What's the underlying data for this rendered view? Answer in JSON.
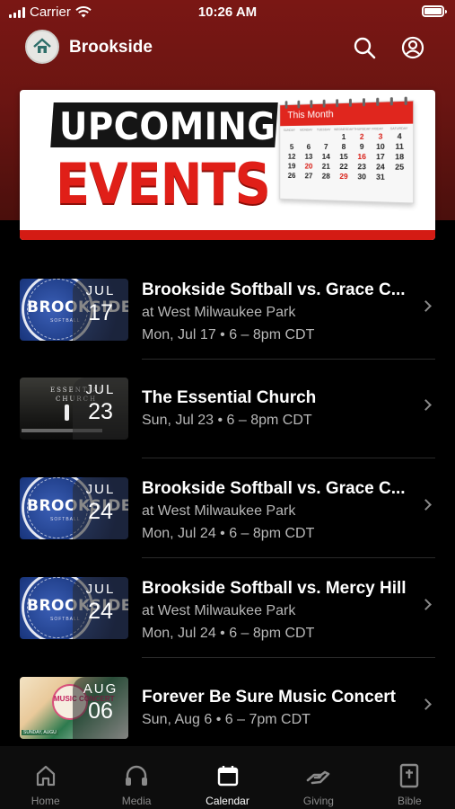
{
  "status_bar": {
    "carrier": "Carrier",
    "time": "10:26 AM"
  },
  "app_bar": {
    "title": "Brookside"
  },
  "banner": {
    "line1": "UPCOMING",
    "line2": "EVENTS",
    "calendar_header": "This Month",
    "calendar_days": [
      "SUNDAY",
      "MONDAY",
      "TUESDAY",
      "WEDNESDAY",
      "THURSDAY",
      "FRIDAY",
      "SATURDAY"
    ],
    "calendar_dates": [
      "",
      "",
      "",
      "1",
      "2",
      "3",
      "4",
      "5",
      "6",
      "7",
      "8",
      "9",
      "10",
      "11",
      "12",
      "13",
      "14",
      "15",
      "16",
      "17",
      "18",
      "19",
      "20",
      "21",
      "22",
      "23",
      "24",
      "25",
      "26",
      "27",
      "28",
      "29",
      "30",
      "31",
      ""
    ],
    "calendar_red_dates": [
      "2",
      "3",
      "16",
      "20",
      "29"
    ]
  },
  "events": [
    {
      "title": "Brookside Softball vs. Grace C...",
      "location": "at West Milwaukee Park",
      "when": "Mon, Jul 17 • 6 – 8pm CDT",
      "month": "JUL",
      "day": "17",
      "thumb": "softball",
      "thumb_text": "BROOKSIDE",
      "thumb_sub": "SOFTBALL"
    },
    {
      "title": "The Essential Church",
      "location": "",
      "when": "Sun, Jul 23 • 6 – 8pm CDT",
      "month": "JUL",
      "day": "23",
      "thumb": "church",
      "thumb_text": "ESSENTIAL",
      "thumb_sub": "CHURCH"
    },
    {
      "title": "Brookside Softball vs. Grace C...",
      "location": "at West Milwaukee Park",
      "when": "Mon, Jul 24 • 6 – 8pm CDT",
      "month": "JUL",
      "day": "24",
      "thumb": "softball",
      "thumb_text": "BROOKSIDE",
      "thumb_sub": "SOFTBALL"
    },
    {
      "title": "Brookside Softball vs. Mercy Hill",
      "location": "at West Milwaukee Park",
      "when": "Mon, Jul 24 • 6 – 8pm CDT",
      "month": "JUL",
      "day": "24",
      "thumb": "softball",
      "thumb_text": "BROOKSIDE",
      "thumb_sub": "SOFTBALL"
    },
    {
      "title": "Forever Be Sure Music Concert",
      "location": "",
      "when": "Sun, Aug 6 • 6 – 7pm CDT",
      "month": "AUG",
      "day": "06",
      "thumb": "concert",
      "thumb_text": "MUSIC CONCERT",
      "thumb_sub": "SUNDAY, AUGU"
    }
  ],
  "tabs": [
    {
      "label": "Home",
      "icon": "home-icon",
      "active": false
    },
    {
      "label": "Media",
      "icon": "headphones-icon",
      "active": false
    },
    {
      "label": "Calendar",
      "icon": "calendar-icon",
      "active": true
    },
    {
      "label": "Giving",
      "icon": "giving-hand-icon",
      "active": false
    },
    {
      "label": "Bible",
      "icon": "bible-icon",
      "active": false
    }
  ],
  "colors": {
    "header": "#6b1512",
    "accent_red": "#e01f18",
    "background": "#000000",
    "tab_inactive": "#8a8a8a"
  }
}
